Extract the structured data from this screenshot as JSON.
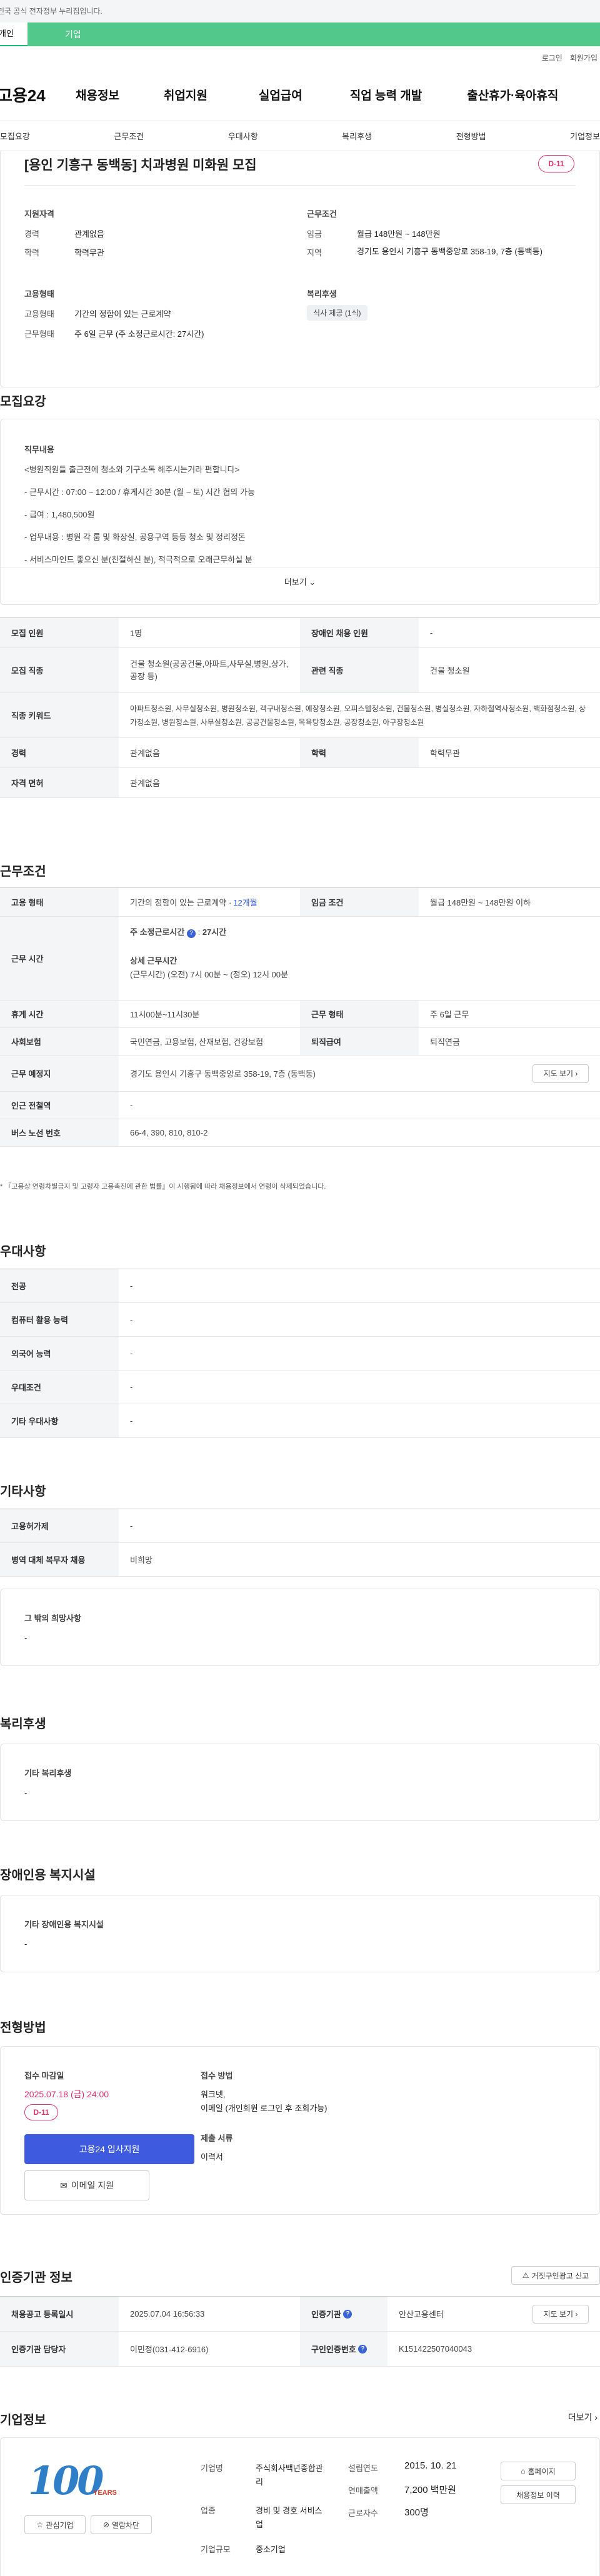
{
  "notice": "이 누리집은 대한민국 공식 전자정부 누리집입니다.",
  "tabs": [
    "개인",
    "기업"
  ],
  "utils": [
    "로그인",
    "회원가입"
  ],
  "gnb": {
    "logo": "고용24",
    "items": [
      "채용정보",
      "취업지원",
      "실업급여",
      "직업 능력 개발",
      "출산휴가·육아휴직"
    ]
  },
  "subnav": [
    "모집요강",
    "근무조건",
    "우대사항",
    "복리후생",
    "전형방법",
    "기업정보"
  ],
  "header": {
    "title": "[용인 기흥구 동백동] 치과병원 미화원 모집",
    "dday": "D-11",
    "qual_title": "지원자격",
    "career_label": "경력",
    "career": "관계없음",
    "edu_label": "학력",
    "edu": "학력무관",
    "cond_title": "근무조건",
    "wage_label": "임금",
    "wage": "월급 148만원 ~ 148만원",
    "loc_label": "지역",
    "loc": "경기도 용인시 기흥구 동백중앙로 358-19, 7층 (동백동)",
    "emp_title": "고용형태",
    "emptype_label": "고용형태",
    "emptype": "기간의 정함이 있는 근로계약",
    "work_label": "근무형태",
    "work": "주 6일 근무 (주 소정근로시간: 27시간)",
    "welfare_title": "복리후생",
    "welfare_tag": "식사 제공 (1식)"
  },
  "recruit": {
    "title": "모집요강",
    "job_title": "직무내용",
    "lines": [
      "<병원직원들 출근전에 청소와 기구소독 해주시는거라 편합니다>",
      "- 근무시간 : 07:00 ~ 12:00 / 휴게시간 30분 (월 ~ 토) 시간 협의 가능",
      "- 급여 : 1,480,500원",
      "- 업무내용 : 병원 각 룸 및 화장실, 공용구역 등등 청소 및 정리정돈",
      "- 서비스마인드 좋으신 분(친절하신 분), 적극적으로 오래근무하실 분"
    ],
    "more": "더보기",
    "table": {
      "headcount_label": "모집 인원",
      "headcount": "1명",
      "disabled_label": "장애인 채용 인원",
      "disabled": "-",
      "job_label": "모집 직종",
      "job": "건물 청소원(공공건물,아파트,사무실,병원,상가,공장 등)",
      "rel_label": "관련 직종",
      "rel": "건물 청소원",
      "kw_label": "직종 키워드",
      "kw": "아파트청소원, 사무실청소원, 병원청소원, 객구내청소원, 예장청소원, 오피스텔청소원, 건물청소원, 병실청소원, 자하철역사청소원, 백화점청소원, 상가청소원, 병원청소원, 사무실청소원, 공공건물청소원, 목욕탕청소원, 공장청소원, 아구장청소원",
      "career_label": "경력",
      "career": "관계없음",
      "edu_label": "학력",
      "edu": "학력무관",
      "license_label": "자격 면허",
      "license": "관계없음"
    }
  },
  "cond": {
    "title": "근무조건",
    "emp_label": "고용 형태",
    "emp": "기간의 정함이 있는 근로계약 · ",
    "emp_months": "12개월",
    "wage_label": "임금 조건",
    "wage": "월급 148만원 ~ 148만원 이하",
    "hours_label": "근무 시간",
    "weekly_label": "주 소정근로시간",
    "weekly": "27시간",
    "detail_label": "상세 근무시간",
    "detail": "(근무시간) (오전) 7시 00분 ~ (정오) 12시 00분",
    "rest_label": "휴게 시간",
    "rest": "11시00분~11시30분",
    "form_label": "근무 형태",
    "form": "주 6일 근무",
    "ins_label": "사회보험",
    "ins": "국민연금, 고용보험, 산재보험, 건강보험",
    "sev_label": "퇴직급여",
    "sev": "퇴직연금",
    "place_label": "근무 예정지",
    "place": "경기도 용인시 기흥구 동백중앙로 358-19, 7층 (동백동)",
    "map_btn": "지도 보기",
    "subway_label": "인근 전철역",
    "subway": "-",
    "bus_label": "버스 노선 번호",
    "bus": "66-4, 390, 810, 810-2",
    "note": "* 『고용상 연령차별금지 및 고령자 고용촉진에 관한 법률』이 시행됨에 따라 채용정보에서 연령이 삭제되었습니다."
  },
  "pref": {
    "title": "우대사항",
    "rows": [
      [
        "전공",
        "-"
      ],
      [
        "컴퓨터 활용 능력",
        "-"
      ],
      [
        "외국어 능력",
        "-"
      ],
      [
        "우대조건",
        "-"
      ],
      [
        "기타 우대사항",
        "-"
      ]
    ]
  },
  "etc": {
    "title": "기타사항",
    "rows": [
      [
        "고용허가제",
        "-"
      ],
      [
        "병역 대체 복무자 채용",
        "비희망"
      ]
    ],
    "box_label": "그 밖의 희망사항",
    "box_val": "-"
  },
  "welfare": {
    "title": "복리후생",
    "label": "기타 복리후생",
    "val": "-"
  },
  "disab": {
    "title": "장애인용 복지시설",
    "label": "기타 장애인용 복지시설",
    "val": "-"
  },
  "process": {
    "title": "전형방법",
    "deadline_label": "접수 마감일",
    "deadline": "2025.07.18 (금) 24:00",
    "dday": "D-11",
    "apply": "고용24 입사지원",
    "email": "이메일 지원",
    "method_label": "접수 방법",
    "method1": "워크넷,",
    "method2": "이메일 (개인회원 로그인 후 조회가능)",
    "docs_label": "제출 서류",
    "docs": "이력서"
  },
  "cert": {
    "title": "인증기관 정보",
    "report": "거짓구인광고 신고",
    "reg_label": "채용공고 등록일시",
    "reg": "2025.07.04 16:56:33",
    "org_label": "인증기관",
    "org": "안산고용센터",
    "map_btn": "지도 보기",
    "mgr_label": "인증기관 담당자",
    "mgr": "이민정(031-412-6916)",
    "no_label": "구인인증번호",
    "no": "K151422507040043"
  },
  "company": {
    "title": "기업정보",
    "more": "더보기",
    "fav": "관심기업",
    "block": "열람차단",
    "ind_label": "기업명",
    "ind": "주식회사백년종합관리",
    "biz_label": "업종",
    "biz": "경비 및 경호 서비스업",
    "size_label": "기업규모",
    "size": "중소기업",
    "est_label": "설립연도",
    "est": "2015. 10. 21",
    "sales_label": "연매출액",
    "sales": "7,200 백만원",
    "emp_label": "근로자수",
    "emp": "300명",
    "home": "홈페이지",
    "list": "채용정보 이력",
    "logo_text": "100",
    "logo_sub": "YEARS"
  }
}
